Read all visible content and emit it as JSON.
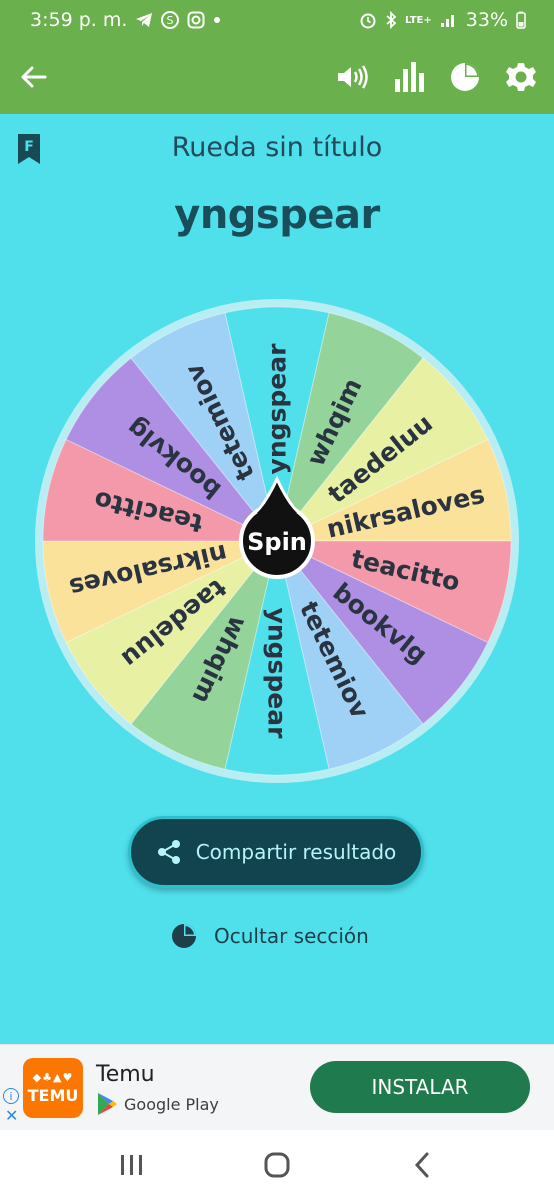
{
  "status_bar": {
    "time": "3:59 p. m.",
    "battery": "33%",
    "network": "LTE+",
    "left_icons": [
      "telegram-icon",
      "circle-s-icon",
      "instagram-icon",
      "dot-icon"
    ],
    "right_icons": [
      "alarm-icon",
      "bluetooth-icon",
      "lte-icon",
      "signal-icon"
    ]
  },
  "app_bar": {
    "back_icon": "arrow-left-icon",
    "actions": [
      "volume-icon",
      "bar-chart-icon",
      "pie-chart-icon",
      "gear-icon"
    ]
  },
  "header": {
    "badge_letter": "F",
    "title": "Rueda sin título",
    "winner": "yngspear"
  },
  "wheel": {
    "center_label": "Spin",
    "segments": [
      {
        "label": "yngspear",
        "color": "#4fe0ec"
      },
      {
        "label": "whqim",
        "color": "#94d39a"
      },
      {
        "label": "taedeluu",
        "color": "#e8f0a4"
      },
      {
        "label": "nikrsaloves",
        "color": "#fbe29b"
      },
      {
        "label": "teacitto",
        "color": "#f499a9"
      },
      {
        "label": "bookvlg",
        "color": "#ae8fe4"
      },
      {
        "label": "tetemiov",
        "color": "#9fd0f5"
      },
      {
        "label": "yngspear",
        "color": "#4fe0ec"
      },
      {
        "label": "whqim",
        "color": "#94d39a"
      },
      {
        "label": "taedeluu",
        "color": "#e8f0a4"
      },
      {
        "label": "nikrsaloves",
        "color": "#fbe29b"
      },
      {
        "label": "teacitto",
        "color": "#f499a9"
      },
      {
        "label": "bookvlg",
        "color": "#ae8fe4"
      },
      {
        "label": "tetemiov",
        "color": "#9fd0f5"
      }
    ]
  },
  "actions": {
    "share_label": "Compartir resultado",
    "hide_label": "Ocultar sección"
  },
  "ad": {
    "app_name": "Temu",
    "logo_text": "TEMU",
    "store": "Google Play",
    "install_label": "INSTALAR"
  },
  "colors": {
    "app_bar": "#6ab04c",
    "background": "#4fe0ec",
    "text_dark": "#1a4d5a",
    "button_dark": "#12444f",
    "install_green": "#1f7a4d",
    "temu_orange": "#fb7701"
  }
}
